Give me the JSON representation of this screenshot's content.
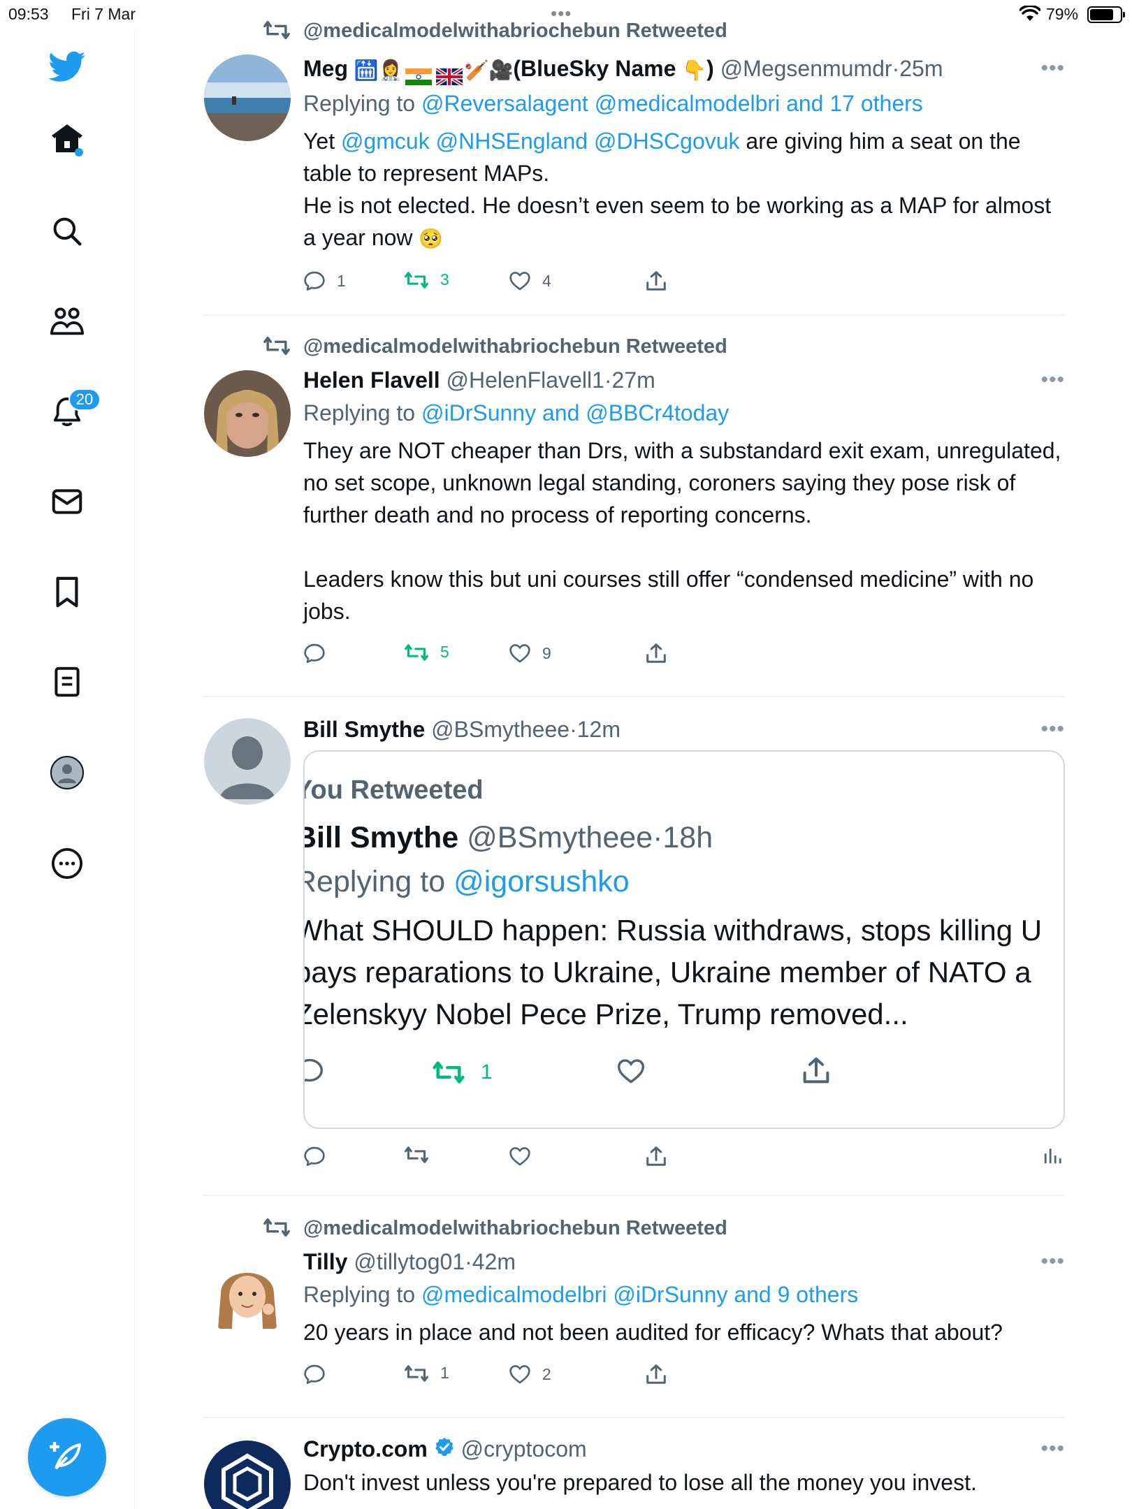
{
  "status_bar": {
    "time": "09:53",
    "date": "Fri 7 Mar",
    "battery": "79%",
    "battery_level": 0.79
  },
  "sidebar": {
    "notification_count": "20",
    "items": [
      "home",
      "search",
      "communities",
      "notifications",
      "messages",
      "bookmarks",
      "lists",
      "profile",
      "more"
    ]
  },
  "tweets": [
    {
      "retweeted_by": "@medicalmodelwithabriochebun Retweeted",
      "name_prefix": "Meg",
      "name_suffix": "(BlueSky Name",
      "name_close": ")",
      "handle": "@Megsenmumdr",
      "dot": "·",
      "time": "25m",
      "reply_prefix": "Replying to",
      "reply_targets": "@Reversalagent @medicalmodelbri and 17 others",
      "text_a": "Yet ",
      "text_mentions": "@gmcuk @NHSEngland @DHSCgovuk",
      "text_b": " are giving him a seat on the table to represent MAPs.\nHe is not elected. He doesn’t even seem to be working as a MAP for almost a year now ",
      "text_emoji": "🥺",
      "replies": "1",
      "retweets": "3",
      "likes": "4"
    },
    {
      "retweeted_by": "@medicalmodelwithabriochebun Retweeted",
      "name": "Helen Flavell",
      "handle": "@HelenFlavell1",
      "dot": "·",
      "time": "27m",
      "reply_prefix": "Replying to",
      "reply_targets": "@iDrSunny and @BBCr4today",
      "text": "They are NOT cheaper than Drs, with a substandard exit exam, unregulated, no set scope, unknown legal standing, coroners saying they pose risk of further death and no process of reporting concerns.\n\nLeaders know this but uni courses still offer “condensed medicine” with no jobs.",
      "replies": "",
      "retweets": "5",
      "likes": "9"
    },
    {
      "name": "Bill Smythe",
      "handle": "@BSmytheee",
      "dot": "·",
      "time": "12m",
      "quote": {
        "retweeted": "You Retweeted",
        "name": "Bill Smythe",
        "handle": "@BSmytheee",
        "dot": "·",
        "time": "18h",
        "reply_prefix": "Replying to",
        "reply_target": "@igorsushko",
        "line1": "What SHOULD happen: Russia withdraws, stops killing U",
        "line2": "pays reparations to Ukraine, Ukraine member of NATO a",
        "line3": "Zelenskyy Nobel Pece Prize, Trump removed...",
        "retweets": "1"
      }
    },
    {
      "retweeted_by": "@medicalmodelwithabriochebun Retweeted",
      "name": "Tilly",
      "handle": "@tillytog01",
      "dot": "·",
      "time": "42m",
      "reply_prefix": "Replying to",
      "reply_targets": "@medicalmodelbri @iDrSunny and 9 others",
      "text": "20 years in place and not been audited for efficacy? Whats that about?",
      "replies": "",
      "retweets": "1",
      "likes": "2"
    },
    {
      "name": "Crypto.com",
      "handle": "@cryptocom",
      "text": "Don't invest unless you're prepared to lose all the money you invest."
    }
  ],
  "colors": {
    "accent": "#1d9bf0",
    "retweet_green": "#00ba7c",
    "secondary": "#536471"
  }
}
